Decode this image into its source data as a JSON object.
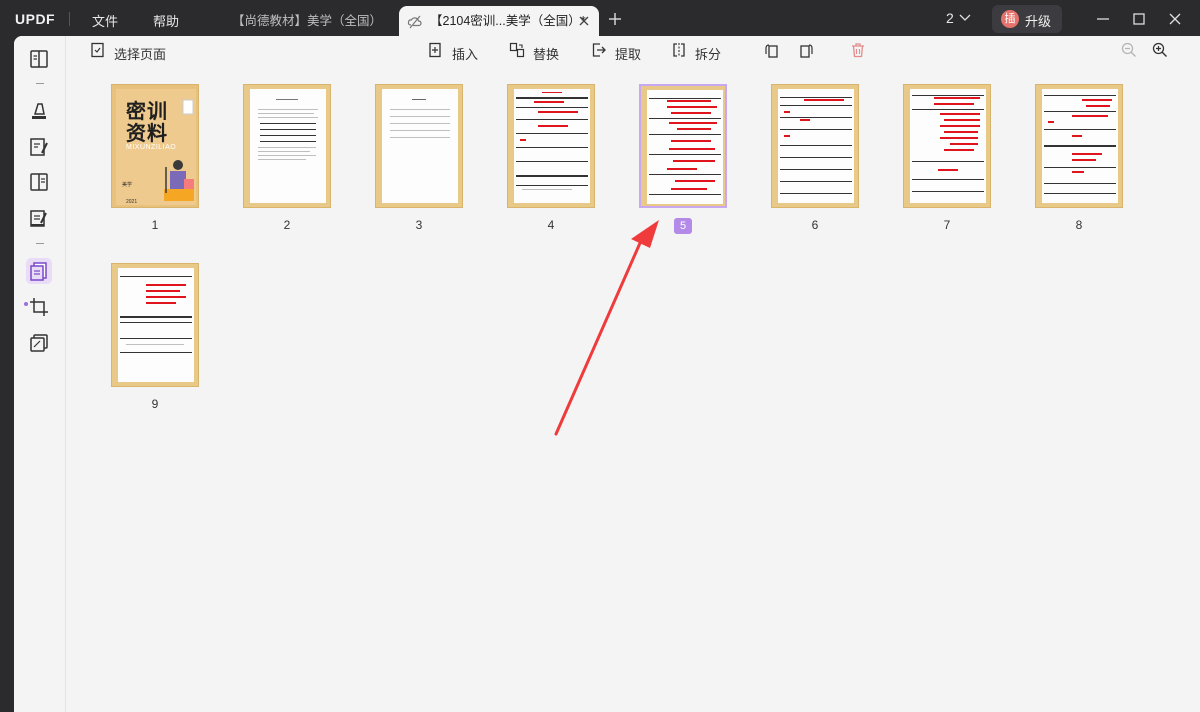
{
  "app": {
    "logo": "UPDF",
    "menus": [
      "文件",
      "帮助"
    ]
  },
  "tabs": [
    {
      "label": "【尚德教材】美学（全国）"
    },
    {
      "label": "【2104密训...美学（全国）*"
    }
  ],
  "titlebar": {
    "page_count": "2",
    "upgrade_avatar": "插",
    "upgrade_label": "升级"
  },
  "toolbar": {
    "select_pages": "选择页面",
    "insert": "插入",
    "replace": "替换",
    "extract": "提取",
    "split": "拆分"
  },
  "thumbnails": [
    {
      "label": "1"
    },
    {
      "label": "2"
    },
    {
      "label": "3"
    },
    {
      "label": "4"
    },
    {
      "label": "5"
    },
    {
      "label": "6"
    },
    {
      "label": "7"
    },
    {
      "label": "8"
    },
    {
      "label": "9"
    }
  ],
  "selected_page": "5",
  "cover": {
    "line1": "密训",
    "line2": "资料",
    "sub": "MIXUNZILIAO",
    "subject": "美学",
    "year": "2021"
  },
  "colors": {
    "accent": "#b48ae9",
    "annotation_arrow": "#ef3b3b",
    "thumbnail_frame": "#e8c987",
    "redaction": "#e0141c"
  }
}
